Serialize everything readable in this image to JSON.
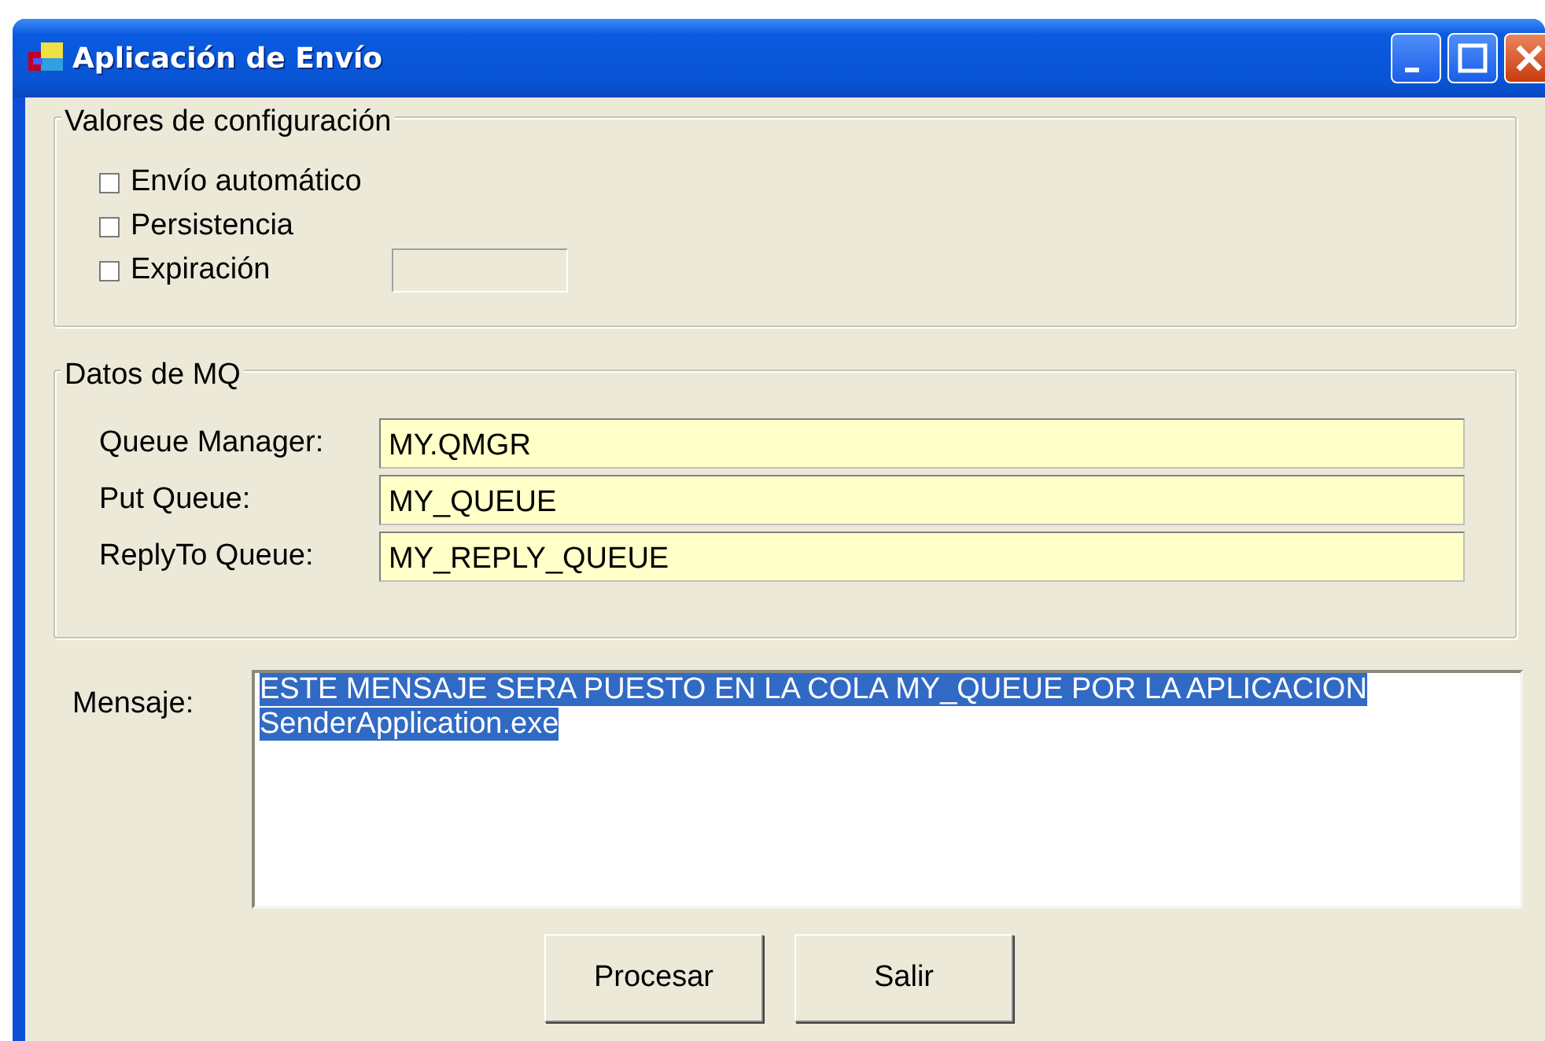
{
  "window": {
    "title": "Aplicación de Envío"
  },
  "config_group": {
    "title": "Valores de configuración",
    "options": [
      {
        "label": "Envío automático",
        "checked": false
      },
      {
        "label": "Persistencia",
        "checked": false
      },
      {
        "label": "Expiración",
        "checked": false,
        "has_field": true,
        "field_disabled": true
      }
    ]
  },
  "mq_group": {
    "title": "Datos de MQ",
    "fields": [
      {
        "label": "Queue Manager:",
        "value": "MY.QMGR"
      },
      {
        "label": "Put Queue:",
        "value": "MY_QUEUE"
      },
      {
        "label": "ReplyTo Queue:",
        "value": "MY_REPLY_QUEUE"
      }
    ]
  },
  "message": {
    "label": "Mensaje:",
    "value": "ESTE MENSAJE SERA PUESTO EN LA COLA MY_QUEUE POR LA APLICACION SenderApplication.exe",
    "selected": true
  },
  "buttons": [
    "Procesar",
    "Salir"
  ]
}
